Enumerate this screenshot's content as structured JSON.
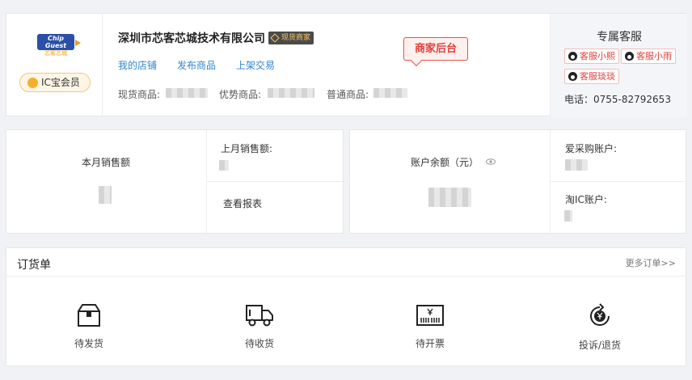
{
  "logo": {
    "line1": "Chip Guest",
    "line2": "芯客芯城"
  },
  "member_badge": "IC宝会员",
  "company": {
    "name": "深圳市芯客芯城技术有限公司",
    "badge": "现货商家"
  },
  "links": {
    "store": "我的店铺",
    "publish": "发布商品",
    "shelf": "上架交易"
  },
  "backend_button": "商家后台",
  "goods_stats": {
    "spot": "现货商品:",
    "advantage": "优势商品:",
    "normal": "普通商品:"
  },
  "service": {
    "title": "专属客服",
    "agents": [
      "客服小熙",
      "客服小雨",
      "客服琰琰"
    ],
    "phone": "电话：0755-82792653"
  },
  "sales": {
    "this_month": "本月销售额",
    "last_month": "上月销售额:",
    "report_link": "查看报表"
  },
  "accounts": {
    "balance": "账户余额（元）",
    "aicaigou": "爱采购账户:",
    "taoic": "淘IC账户:"
  },
  "orders": {
    "title": "订货单",
    "more": "更多订单>>",
    "items": [
      {
        "label": "待发货",
        "icon": "box-icon"
      },
      {
        "label": "待收货",
        "icon": "truck-icon"
      },
      {
        "label": "待开票",
        "icon": "invoice-icon"
      },
      {
        "label": "投诉/退货",
        "icon": "refund-icon"
      }
    ]
  },
  "colors": {
    "link": "#2f86d4",
    "accent_red": "#e0403a",
    "badge_gold": "#f3c66e"
  }
}
